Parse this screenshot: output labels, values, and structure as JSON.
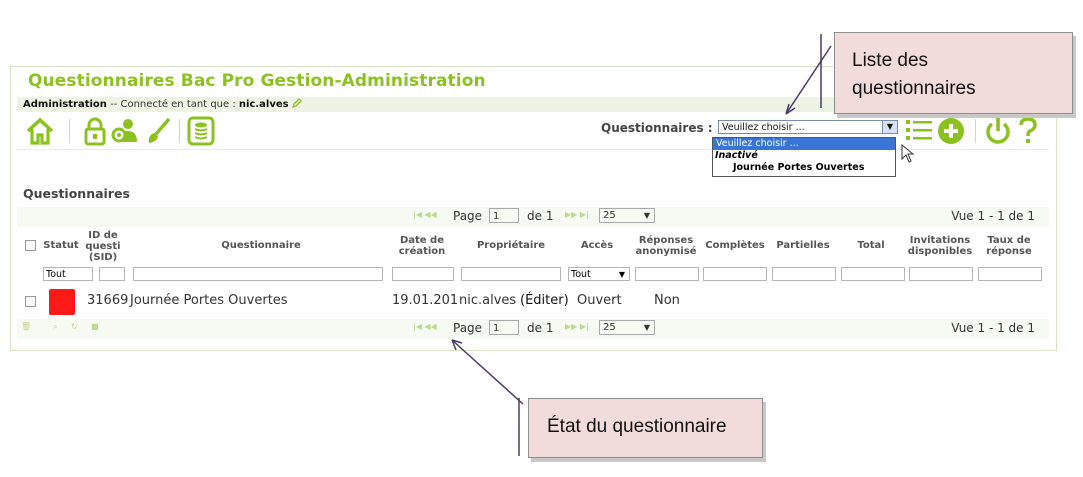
{
  "app": {
    "title": "Questionnaires Bac Pro Gestion-Administration",
    "admin_label": "Administration",
    "connected_text": " -- Connecté en tant que : ",
    "user": "nic.alves"
  },
  "toolbar": {
    "questionnaires_label": "Questionnaires :",
    "select_value": "Veuillez choisir ...",
    "dropdown_options": [
      {
        "label": "Veuillez choisir ...",
        "selected": true
      },
      {
        "label": "Inactivé",
        "group": true
      },
      {
        "label": "Journée Portes Ouvertes"
      }
    ]
  },
  "section_title": "Questionnaires",
  "pager": {
    "page_label": "Page",
    "page_value": "1",
    "of_label": "de 1",
    "rows_value": "25",
    "view_text": "Vue 1 - 1 de 1"
  },
  "table": {
    "headers": [
      "Statut",
      "ID de questi (SID)",
      "Questionnaire",
      "Date de création",
      "Propriétaire",
      "Accès",
      "Réponses anonymisé",
      "Complètes",
      "Partielles",
      "Total",
      "Invitations disponibles",
      "Taux de réponse"
    ],
    "filter_status": "Tout",
    "filter_access": "Tout",
    "rows": [
      {
        "status_color": "#ff1a1a",
        "sid": "31669",
        "name": "Journée Portes Ouvertes",
        "date": "19.01.201",
        "owner": "nic.alves",
        "edit": "(Éditer)",
        "access": "Ouvert",
        "anon": "Non"
      }
    ]
  },
  "callouts": {
    "list": "Liste des questionnaires",
    "state": "État du questionnaire"
  },
  "colors": {
    "accent": "#8cc21f",
    "callout_bg": "#f2dcdb",
    "status_red": "#ff1a1a"
  }
}
